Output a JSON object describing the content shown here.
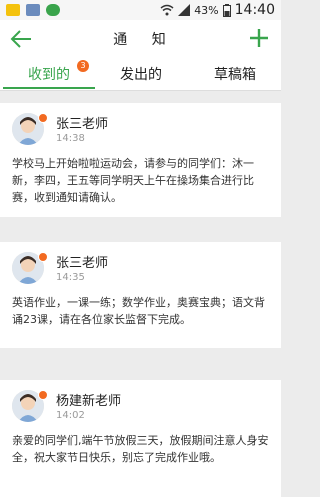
{
  "status_bar": {
    "battery": "43%",
    "time": "14:40",
    "icons": [
      "warning-icon",
      "photo-icon",
      "wechat-icon"
    ],
    "right_icons": [
      "wifi-icon",
      "signal-icon",
      "battery-icon"
    ]
  },
  "header": {
    "title": "通 知",
    "back_icon": "back-arrow-icon",
    "add_icon": "plus-icon"
  },
  "tabs": [
    {
      "label": "收到的",
      "active": true,
      "badge": "3"
    },
    {
      "label": "发出的",
      "active": false
    },
    {
      "label": "草稿箱",
      "active": false
    }
  ],
  "messages": [
    {
      "sender": "张三老师",
      "time": "14:38",
      "content": "学校马上开始啦啦运动会，请参与的同学们：沐一新，李四，王五等同学明天上午在操场集合进行比赛，收到通知请确认。"
    },
    {
      "sender": "张三老师",
      "time": "14:35",
      "content": "英语作业，一课一练；数学作业，奥赛宝典；语文背诵23课，请在各位家长监督下完成。"
    },
    {
      "sender": "杨建新老师",
      "time": "14:02",
      "content": "亲爱的同学们,端午节放假三天，放假期间注意人身安全，祝大家节日快乐，别忘了完成作业哦。"
    }
  ],
  "colors": {
    "accent": "#39a54d",
    "badge": "#f26a21",
    "background": "#ececec"
  }
}
